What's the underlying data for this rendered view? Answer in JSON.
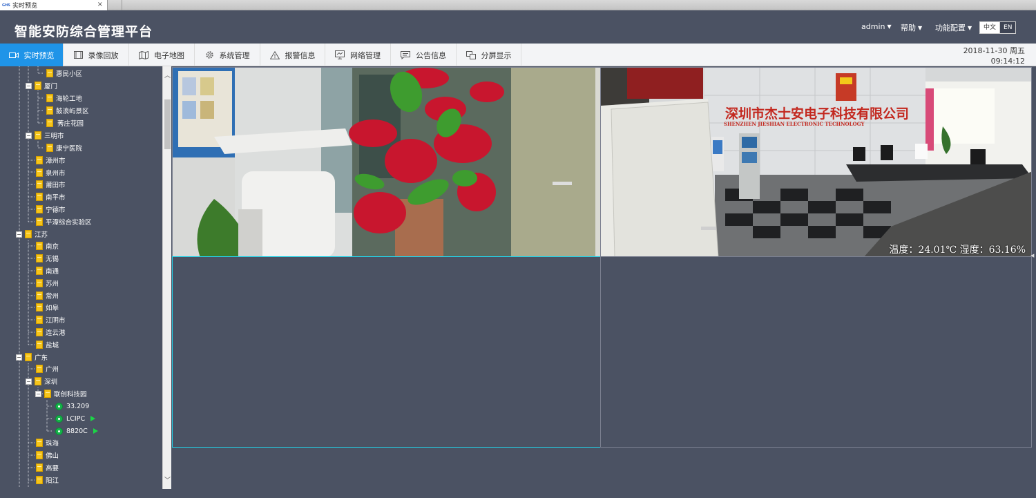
{
  "browser_tab": {
    "favicon": "GHS",
    "title": "实时预览",
    "close": "×"
  },
  "header": {
    "title": "智能安防综合管理平台",
    "user": "admin",
    "help": "帮助",
    "config": "功能配置",
    "lang_zh": "中文",
    "lang_en": "EN"
  },
  "nav": {
    "items": [
      {
        "label": "实时预览",
        "icon": "video-icon"
      },
      {
        "label": "录像回放",
        "icon": "film-icon"
      },
      {
        "label": "电子地图",
        "icon": "map-icon"
      },
      {
        "label": "系统管理",
        "icon": "gear-icon"
      },
      {
        "label": "报警信息",
        "icon": "alert-icon"
      },
      {
        "label": "网络管理",
        "icon": "network-icon"
      },
      {
        "label": "公告信息",
        "icon": "message-icon"
      },
      {
        "label": "分屏显示",
        "icon": "split-screen-icon"
      }
    ],
    "date": "2018-11-30 周五",
    "time": "09:14:12"
  },
  "tree": [
    {
      "label": "惠民小区"
    },
    {
      "label": "厦门"
    },
    {
      "label": "海轮工地"
    },
    {
      "label": "鼓浪屿景区"
    },
    {
      "label": "莠庄花园"
    },
    {
      "label": "三明市"
    },
    {
      "label": "康宁医院"
    },
    {
      "label": "漳州市"
    },
    {
      "label": "泉州市"
    },
    {
      "label": "莆田市"
    },
    {
      "label": "南平市"
    },
    {
      "label": "宁德市"
    },
    {
      "label": "平潭综合实验区"
    },
    {
      "label": "江苏"
    },
    {
      "label": "南京"
    },
    {
      "label": "无锡"
    },
    {
      "label": "南通"
    },
    {
      "label": "苏州"
    },
    {
      "label": "常州"
    },
    {
      "label": "如皋"
    },
    {
      "label": "江阴市"
    },
    {
      "label": "连云港"
    },
    {
      "label": "盐城"
    },
    {
      "label": "广东"
    },
    {
      "label": "广州"
    },
    {
      "label": "深圳"
    },
    {
      "label": "联创科技园"
    },
    {
      "label": "33.209"
    },
    {
      "label": "LCIPC"
    },
    {
      "label": "8820C"
    },
    {
      "label": "珠海"
    },
    {
      "label": "佛山"
    },
    {
      "label": "高要"
    },
    {
      "label": "阳江"
    }
  ],
  "video": {
    "cell2_sign": "深圳市杰士安电子科技有限公司",
    "cell2_sign_en": "SHENZHEN JIESHIAN ELECTRONIC TECHNOLOGY",
    "cell2_osd": "温度：24.01℃ 湿度：63.16%"
  }
}
